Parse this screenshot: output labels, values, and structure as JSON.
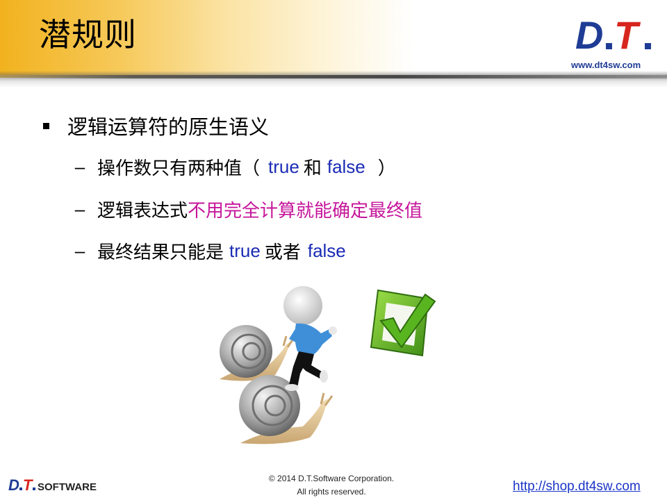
{
  "header": {
    "title": "潜规则",
    "logo_text": "D.T.",
    "site_url": "www.dt4sw.com"
  },
  "content": {
    "main_bullet": "逻辑运算符的原生语义",
    "sub_items": [
      {
        "prefix": "操作数只有两种值（",
        "kw1": "true",
        "mid": "和",
        "kw2": "false",
        "suffix": "）"
      },
      {
        "prefix": "逻辑表达式",
        "highlight": "不用完全计算就能确定最终值"
      },
      {
        "prefix": "最终结果只能是",
        "kw1": "true",
        "mid": "或者",
        "kw2": "false"
      }
    ]
  },
  "footer": {
    "brand_prefix": "D.T.",
    "brand_suffix": "SOFTWARE",
    "copyright_line1": "© 2014 D.T.Software Corporation.",
    "copyright_line2": "All rights reserved.",
    "shop_link": "http://shop.dt4sw.com"
  },
  "colors": {
    "header_gold": "#f2b21e",
    "keyword_blue": "#1a2bb5",
    "highlight_magenta": "#c5169a",
    "link_blue": "#1a35c8",
    "logo_blue": "#1f3c95",
    "logo_red": "#d7261e"
  }
}
